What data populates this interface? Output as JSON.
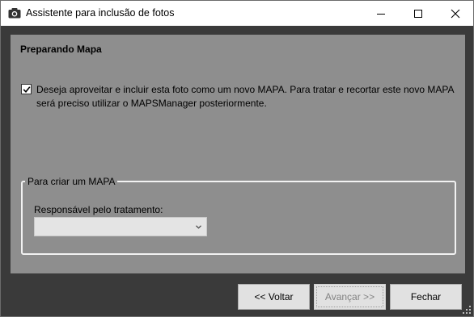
{
  "window": {
    "title": "Assistente para inclusão de fotos",
    "title_icon": "camera-icon"
  },
  "section": {
    "title": "Preparando Mapa"
  },
  "checkbox": {
    "checked": true,
    "label": "Deseja aproveitar e incluir esta foto como um novo MAPA. Para tratar e recortar este novo MAPA será preciso utilizar o MAPSManager posteriormente."
  },
  "group": {
    "legend": "Para criar um MAPA",
    "field_label": "Responsável pelo tratamento:",
    "select_value": ""
  },
  "buttons": {
    "back": "<< Voltar",
    "next": "Avançar >>",
    "close": "Fechar"
  }
}
